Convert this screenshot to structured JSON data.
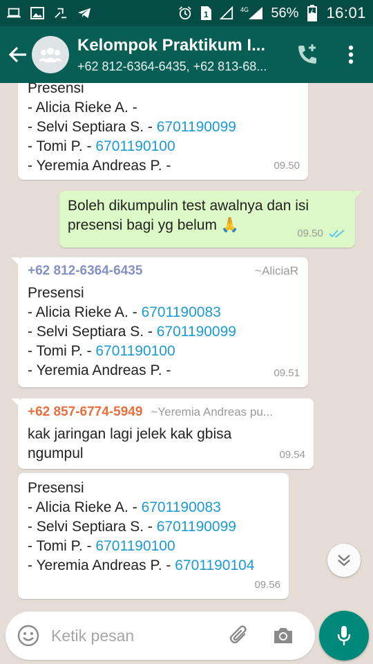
{
  "status_bar": {
    "battery_percent": "56%",
    "time": "16:01",
    "network": "4G"
  },
  "header": {
    "title": "Kelompok Praktikum I...",
    "subtitle": "+62 812-6364-6435, +62 813-68..."
  },
  "input": {
    "placeholder": "Ketik pesan"
  },
  "messages": [
    {
      "lines": [
        "Presensi",
        "- Alicia Rieke A. -",
        "- Selvi Septiara S. - ",
        "- Tomi P. - ",
        "- Yeremia Andreas P. -"
      ],
      "links": [
        "",
        "",
        "6701190099",
        "6701190100",
        ""
      ],
      "time": "09.50"
    },
    {
      "text1": "Boleh dikumpulin test awalnya dan isi",
      "text2": "presensi bagi yg belum ",
      "emoji": "🙏",
      "time": "09.50"
    },
    {
      "sender": "+62 812-6364-6435",
      "alias": "~AliciaR",
      "sender_color": "#8590c7",
      "lines": [
        "Presensi",
        "- Alicia Rieke A. - ",
        "- Selvi Septiara S. - ",
        "- Tomi P. - ",
        "- Yeremia Andreas P. -"
      ],
      "links": [
        "",
        "6701190083",
        "6701190099",
        "6701190100",
        ""
      ],
      "time": "09.51"
    },
    {
      "sender": "+62 857-6774-5949",
      "alias": "~Yeremia Andreas pu...",
      "sender_color": "#e96e3c",
      "text1": "kak jaringan lagi jelek kak gbisa",
      "text2": "ngumpul",
      "time": "09.54"
    },
    {
      "lines": [
        "Presensi",
        "- Alicia Rieke A. - ",
        "- Selvi Septiara S. - ",
        "- Tomi P. - ",
        "- Yeremia Andreas P. - "
      ],
      "links": [
        "",
        "6701190083",
        "6701190099",
        "6701190100",
        "6701190104"
      ],
      "time": "09.56"
    }
  ],
  "colors": {
    "status_bar": "#054d44",
    "app_bar": "#075e54",
    "link": "#1a9ad6",
    "outgoing_bubble": "#dcf8c6",
    "mic_button": "#00897b",
    "read_ticks": "#4fc3f7"
  }
}
